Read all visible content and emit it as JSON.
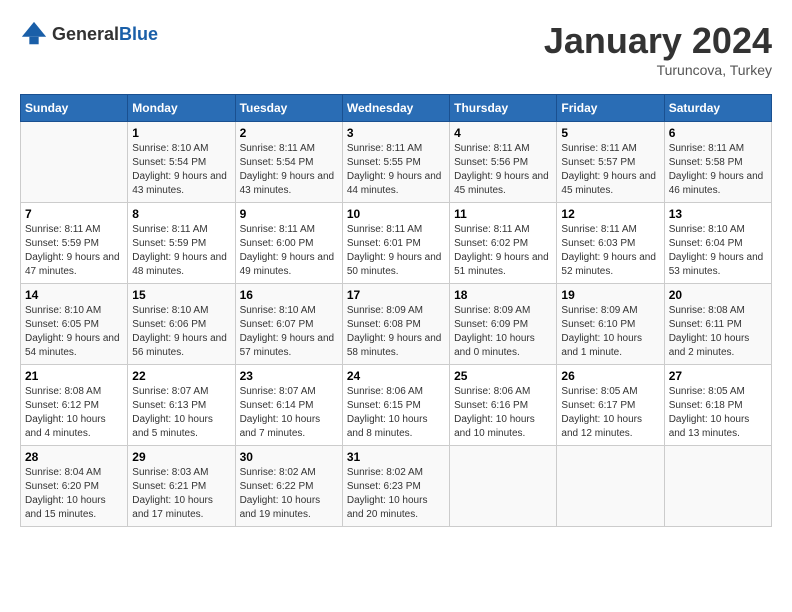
{
  "header": {
    "logo_general": "General",
    "logo_blue": "Blue",
    "month_title": "January 2024",
    "location": "Turuncova, Turkey"
  },
  "weekdays": [
    "Sunday",
    "Monday",
    "Tuesday",
    "Wednesday",
    "Thursday",
    "Friday",
    "Saturday"
  ],
  "weeks": [
    [
      {
        "day": "",
        "sunrise": "",
        "sunset": "",
        "daylight": ""
      },
      {
        "day": "1",
        "sunrise": "Sunrise: 8:10 AM",
        "sunset": "Sunset: 5:54 PM",
        "daylight": "Daylight: 9 hours and 43 minutes."
      },
      {
        "day": "2",
        "sunrise": "Sunrise: 8:11 AM",
        "sunset": "Sunset: 5:54 PM",
        "daylight": "Daylight: 9 hours and 43 minutes."
      },
      {
        "day": "3",
        "sunrise": "Sunrise: 8:11 AM",
        "sunset": "Sunset: 5:55 PM",
        "daylight": "Daylight: 9 hours and 44 minutes."
      },
      {
        "day": "4",
        "sunrise": "Sunrise: 8:11 AM",
        "sunset": "Sunset: 5:56 PM",
        "daylight": "Daylight: 9 hours and 45 minutes."
      },
      {
        "day": "5",
        "sunrise": "Sunrise: 8:11 AM",
        "sunset": "Sunset: 5:57 PM",
        "daylight": "Daylight: 9 hours and 45 minutes."
      },
      {
        "day": "6",
        "sunrise": "Sunrise: 8:11 AM",
        "sunset": "Sunset: 5:58 PM",
        "daylight": "Daylight: 9 hours and 46 minutes."
      }
    ],
    [
      {
        "day": "7",
        "sunrise": "Sunrise: 8:11 AM",
        "sunset": "Sunset: 5:59 PM",
        "daylight": "Daylight: 9 hours and 47 minutes."
      },
      {
        "day": "8",
        "sunrise": "Sunrise: 8:11 AM",
        "sunset": "Sunset: 5:59 PM",
        "daylight": "Daylight: 9 hours and 48 minutes."
      },
      {
        "day": "9",
        "sunrise": "Sunrise: 8:11 AM",
        "sunset": "Sunset: 6:00 PM",
        "daylight": "Daylight: 9 hours and 49 minutes."
      },
      {
        "day": "10",
        "sunrise": "Sunrise: 8:11 AM",
        "sunset": "Sunset: 6:01 PM",
        "daylight": "Daylight: 9 hours and 50 minutes."
      },
      {
        "day": "11",
        "sunrise": "Sunrise: 8:11 AM",
        "sunset": "Sunset: 6:02 PM",
        "daylight": "Daylight: 9 hours and 51 minutes."
      },
      {
        "day": "12",
        "sunrise": "Sunrise: 8:11 AM",
        "sunset": "Sunset: 6:03 PM",
        "daylight": "Daylight: 9 hours and 52 minutes."
      },
      {
        "day": "13",
        "sunrise": "Sunrise: 8:10 AM",
        "sunset": "Sunset: 6:04 PM",
        "daylight": "Daylight: 9 hours and 53 minutes."
      }
    ],
    [
      {
        "day": "14",
        "sunrise": "Sunrise: 8:10 AM",
        "sunset": "Sunset: 6:05 PM",
        "daylight": "Daylight: 9 hours and 54 minutes."
      },
      {
        "day": "15",
        "sunrise": "Sunrise: 8:10 AM",
        "sunset": "Sunset: 6:06 PM",
        "daylight": "Daylight: 9 hours and 56 minutes."
      },
      {
        "day": "16",
        "sunrise": "Sunrise: 8:10 AM",
        "sunset": "Sunset: 6:07 PM",
        "daylight": "Daylight: 9 hours and 57 minutes."
      },
      {
        "day": "17",
        "sunrise": "Sunrise: 8:09 AM",
        "sunset": "Sunset: 6:08 PM",
        "daylight": "Daylight: 9 hours and 58 minutes."
      },
      {
        "day": "18",
        "sunrise": "Sunrise: 8:09 AM",
        "sunset": "Sunset: 6:09 PM",
        "daylight": "Daylight: 10 hours and 0 minutes."
      },
      {
        "day": "19",
        "sunrise": "Sunrise: 8:09 AM",
        "sunset": "Sunset: 6:10 PM",
        "daylight": "Daylight: 10 hours and 1 minute."
      },
      {
        "day": "20",
        "sunrise": "Sunrise: 8:08 AM",
        "sunset": "Sunset: 6:11 PM",
        "daylight": "Daylight: 10 hours and 2 minutes."
      }
    ],
    [
      {
        "day": "21",
        "sunrise": "Sunrise: 8:08 AM",
        "sunset": "Sunset: 6:12 PM",
        "daylight": "Daylight: 10 hours and 4 minutes."
      },
      {
        "day": "22",
        "sunrise": "Sunrise: 8:07 AM",
        "sunset": "Sunset: 6:13 PM",
        "daylight": "Daylight: 10 hours and 5 minutes."
      },
      {
        "day": "23",
        "sunrise": "Sunrise: 8:07 AM",
        "sunset": "Sunset: 6:14 PM",
        "daylight": "Daylight: 10 hours and 7 minutes."
      },
      {
        "day": "24",
        "sunrise": "Sunrise: 8:06 AM",
        "sunset": "Sunset: 6:15 PM",
        "daylight": "Daylight: 10 hours and 8 minutes."
      },
      {
        "day": "25",
        "sunrise": "Sunrise: 8:06 AM",
        "sunset": "Sunset: 6:16 PM",
        "daylight": "Daylight: 10 hours and 10 minutes."
      },
      {
        "day": "26",
        "sunrise": "Sunrise: 8:05 AM",
        "sunset": "Sunset: 6:17 PM",
        "daylight": "Daylight: 10 hours and 12 minutes."
      },
      {
        "day": "27",
        "sunrise": "Sunrise: 8:05 AM",
        "sunset": "Sunset: 6:18 PM",
        "daylight": "Daylight: 10 hours and 13 minutes."
      }
    ],
    [
      {
        "day": "28",
        "sunrise": "Sunrise: 8:04 AM",
        "sunset": "Sunset: 6:20 PM",
        "daylight": "Daylight: 10 hours and 15 minutes."
      },
      {
        "day": "29",
        "sunrise": "Sunrise: 8:03 AM",
        "sunset": "Sunset: 6:21 PM",
        "daylight": "Daylight: 10 hours and 17 minutes."
      },
      {
        "day": "30",
        "sunrise": "Sunrise: 8:02 AM",
        "sunset": "Sunset: 6:22 PM",
        "daylight": "Daylight: 10 hours and 19 minutes."
      },
      {
        "day": "31",
        "sunrise": "Sunrise: 8:02 AM",
        "sunset": "Sunset: 6:23 PM",
        "daylight": "Daylight: 10 hours and 20 minutes."
      },
      {
        "day": "",
        "sunrise": "",
        "sunset": "",
        "daylight": ""
      },
      {
        "day": "",
        "sunrise": "",
        "sunset": "",
        "daylight": ""
      },
      {
        "day": "",
        "sunrise": "",
        "sunset": "",
        "daylight": ""
      }
    ]
  ]
}
